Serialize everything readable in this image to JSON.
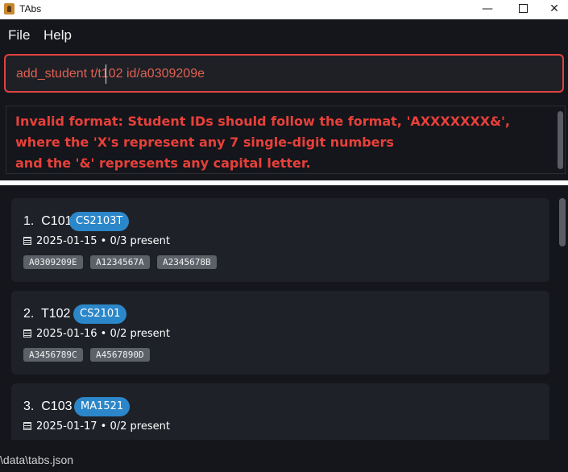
{
  "window": {
    "title": "TAbs",
    "minimize": "—",
    "close": "✕"
  },
  "menu": {
    "file": "File",
    "help": "Help"
  },
  "command": {
    "value": "add_student t/t102 id/a0309209e"
  },
  "result": {
    "lines": [
      "Invalid format: Student IDs should follow the format, 'AXXXXXXX&',",
      "where the 'X's represent any 7 single-digit numbers",
      "and the '&' represents any capital letter."
    ]
  },
  "tutorials": [
    {
      "index": "1.",
      "id": "C101",
      "course": "CS2103T",
      "date": "2025-01-15 • 0/3 present",
      "students": [
        "A0309209E",
        "A1234567A",
        "A2345678B"
      ]
    },
    {
      "index": "2.",
      "id": "T102",
      "course": "CS2101",
      "date": "2025-01-16 • 0/2 present",
      "students": [
        "A3456789C",
        "A4567890D"
      ]
    },
    {
      "index": "3.",
      "id": "C103",
      "course": "MA1521",
      "date": "2025-01-17 • 0/2 present",
      "students": [
        "",
        ""
      ]
    }
  ],
  "status": {
    "path": "\\data\\tabs.json"
  },
  "colors": {
    "accent": "#2b87c9",
    "error": "#e8403a",
    "background": "#14161b",
    "card": "#1e2128"
  },
  "icons": {
    "app": "tabs-app-icon",
    "date": "calendar-icon"
  }
}
